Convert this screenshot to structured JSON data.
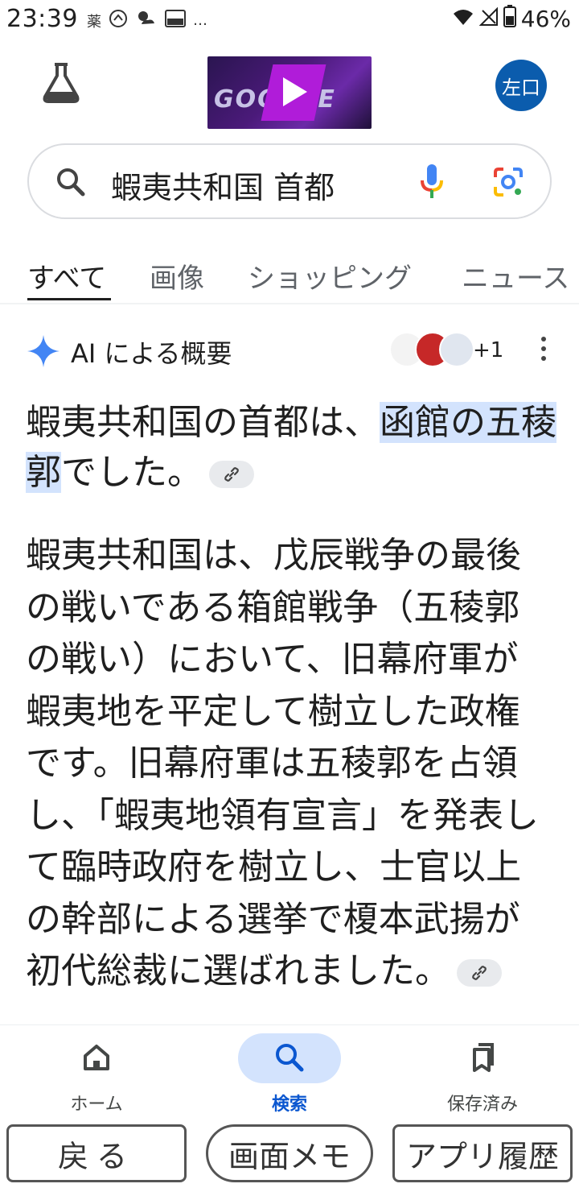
{
  "status_bar": {
    "time": "23:39",
    "left_icons": [
      "薬",
      "blog-icon",
      "weather-icon",
      "my-au-icon",
      "…"
    ],
    "battery": "46%"
  },
  "header": {
    "avatar_text": "左口",
    "doodle_text": "GOOGLE"
  },
  "search": {
    "query": "蝦夷共和国 首都"
  },
  "tabs": [
    {
      "label": "すべて",
      "active": true
    },
    {
      "label": "画像",
      "active": false
    },
    {
      "label": "ショッピング",
      "active": false
    },
    {
      "label": "ニュース",
      "active": false
    }
  ],
  "ai_overview": {
    "title": "AI による概要",
    "source_count": "+1",
    "headline_pre": "蝦夷共和国の首都は、",
    "headline_highlight": "函館の五稜郭",
    "headline_post": "でした。",
    "body": "蝦夷共和国は、戊辰戦争の最後の戦いである箱館戦争（五稜郭の戦い）において、旧幕府軍が蝦夷地を平定して樹立した政権です。旧幕府軍は五稜郭を占領し、「蝦夷地領有宣言」を発表して臨時政府を樹立し、士官以上の幹部による選挙で榎本武揚が初代総裁に選ばれました。"
  },
  "bottom_nav": {
    "home": "ホーム",
    "search": "検索",
    "saved": "保存済み"
  },
  "hardware_buttons": {
    "back": "戻る",
    "memo": "画面メモ",
    "history": "アプリ履歴"
  },
  "colors": {
    "accent": "#0b57d0",
    "highlight": "#d3e3fd",
    "avatar": "#0b5cad"
  }
}
